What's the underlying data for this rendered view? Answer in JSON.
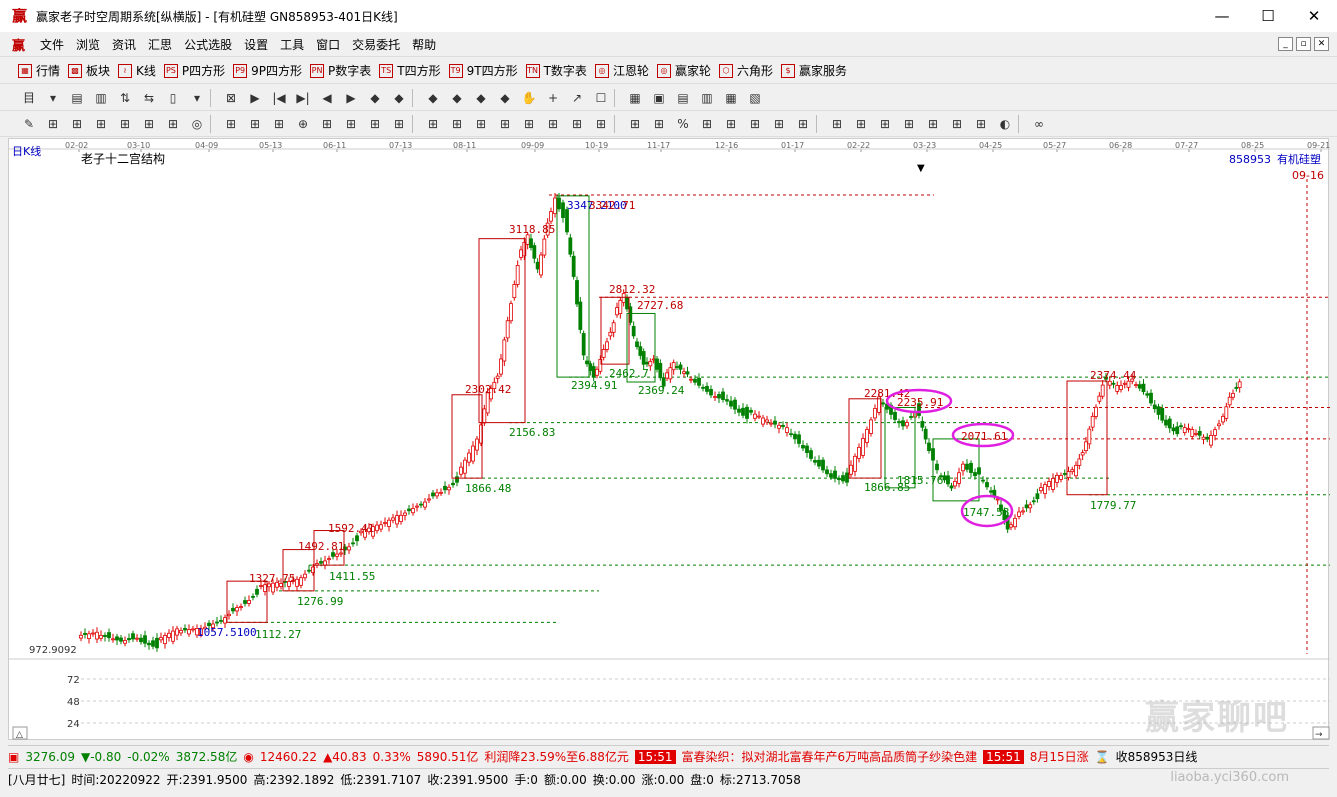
{
  "window": {
    "logo": "赢",
    "title": "赢家老子时空周期系统[纵横版] - [有机硅塑  GN858953-401日K线]",
    "buttons": [
      "—",
      "☐",
      "✕"
    ]
  },
  "menu": {
    "logo": "赢",
    "items": [
      "文件",
      "浏览",
      "资讯",
      "汇思",
      "公式选股",
      "设置",
      "工具",
      "窗口",
      "交易委托",
      "帮助"
    ],
    "right_buttons": [
      "_",
      "▫",
      "✕"
    ]
  },
  "nav": {
    "items": [
      {
        "icon": "grid-icon",
        "glyph": "▦",
        "label": "行情"
      },
      {
        "icon": "blocks-icon",
        "glyph": "▩",
        "label": "板块"
      },
      {
        "icon": "kline-icon",
        "glyph": "≀",
        "label": "K线"
      },
      {
        "icon": "ps-icon",
        "glyph": "PS",
        "label": "P四方形"
      },
      {
        "icon": "p9-icon",
        "glyph": "P9",
        "label": "9P四方形"
      },
      {
        "icon": "pn-icon",
        "glyph": "PN",
        "label": "P数字表"
      },
      {
        "icon": "ts-icon",
        "glyph": "TS",
        "label": "T四方形"
      },
      {
        "icon": "t9-icon",
        "glyph": "T9",
        "label": "9T四方形"
      },
      {
        "icon": "tn-icon",
        "glyph": "TN",
        "label": "T数字表"
      },
      {
        "icon": "wheel-icon",
        "glyph": "◎",
        "label": "江恩轮"
      },
      {
        "icon": "win-wheel-icon",
        "glyph": "◎",
        "label": "赢家轮"
      },
      {
        "icon": "hexagon-icon",
        "glyph": "⬡",
        "label": "六角形"
      },
      {
        "icon": "dollar-icon",
        "glyph": "$",
        "label": "赢家服务"
      }
    ]
  },
  "toolbar2": [
    "目",
    "▾",
    "▤",
    "▥",
    "⇅",
    "⇆",
    "▯",
    "▾",
    "⊠",
    "▶",
    "|◀",
    "▶|",
    "◀",
    "▶",
    "◆",
    "◆",
    "◆",
    "◆",
    "◆",
    "◆",
    "✋",
    "+",
    "↗",
    "☐",
    "▦",
    "▣",
    "▤",
    "▥",
    "▦",
    "▧"
  ],
  "toolbar3": [
    "✎",
    "⊞",
    "⊞",
    "⊞",
    "⊞",
    "⊞",
    "⊞",
    "◎",
    "⊞",
    "⊞",
    "⊞",
    "⊕",
    "⊞",
    "⊞",
    "⊞",
    "⊞",
    "⊞",
    "⊞",
    "⊞",
    "⊞",
    "⊞",
    "⊞",
    "⊞",
    "⊞",
    "⊞",
    "⊞",
    "%",
    "⊞",
    "⊞",
    "⊞",
    "⊞",
    "⊞",
    "⊞",
    "⊞",
    "⊞",
    "⊞",
    "⊞",
    "⊞",
    "⊞",
    "◐",
    "∞"
  ],
  "chart": {
    "period_label": "日K线",
    "study_label": "老子十二宫结构",
    "code": "858953",
    "name": "有机硅塑",
    "last_date": "09-16",
    "date_ticks": [
      "02-02",
      "03-10",
      "04-09",
      "05-13",
      "06-11",
      "07-13",
      "08-11",
      "09-09",
      "10-19",
      "11-17",
      "12-16",
      "01-17",
      "02-22",
      "03-23",
      "04-25",
      "05-27",
      "06-28",
      "07-27",
      "08-25",
      "09-21"
    ],
    "price_axis_label": "972.9092",
    "volume_ticks": [
      "72",
      "48",
      "24"
    ],
    "price_labels": [
      {
        "text": "1057.5100",
        "color": "#0000c0"
      },
      {
        "text": "1112.27",
        "color": "#008000"
      },
      {
        "text": "1327.75",
        "color": "#c00000"
      },
      {
        "text": "1276.99",
        "color": "#008000"
      },
      {
        "text": "1492.81",
        "color": "#c00000"
      },
      {
        "text": "1411.55",
        "color": "#008000"
      },
      {
        "text": "1592.41",
        "color": "#c00000"
      },
      {
        "text": "2302.42",
        "color": "#c00000"
      },
      {
        "text": "1866.48",
        "color": "#008000"
      },
      {
        "text": "3118.85",
        "color": "#c00000"
      },
      {
        "text": "2156.83",
        "color": "#008000"
      },
      {
        "text": "3347.2100",
        "color": "#0000c0"
      },
      {
        "text": "3342.71",
        "color": "#c00000"
      },
      {
        "text": "2394.91",
        "color": "#008000"
      },
      {
        "text": "2812.32",
        "color": "#c00000"
      },
      {
        "text": "2462.7",
        "color": "#008000"
      },
      {
        "text": "2727.68",
        "color": "#c00000"
      },
      {
        "text": "2369.24",
        "color": "#008000"
      },
      {
        "text": "2281.42",
        "color": "#c00000"
      },
      {
        "text": "2235.91",
        "color": "#c00000"
      },
      {
        "text": "1866.85",
        "color": "#008000"
      },
      {
        "text": "1815.76",
        "color": "#008000"
      },
      {
        "text": "2071.61",
        "color": "#c00000"
      },
      {
        "text": "1747.58",
        "color": "#008000"
      },
      {
        "text": "2374.44",
        "color": "#c00000"
      },
      {
        "text": "1779.77",
        "color": "#008000"
      }
    ]
  },
  "status1": {
    "sh_value": "3276.09",
    "sh_change": "▼-0.80",
    "sh_pct": "-0.02%",
    "sh_amount": "3872.58亿",
    "sz_value": "12460.22",
    "sz_change": "▲40.83",
    "sz_pct": "0.33%",
    "sz_amount": "5890.51亿",
    "news1": "利润降23.59%至6.88亿元",
    "time1": "15:51",
    "news2": "富春染织：拟对湖北富春年产6万吨高品质筒子纱染色建",
    "time2": "15:51",
    "news3": "8月15日涨",
    "stock_tail": "收858953日线"
  },
  "status2": {
    "lunar": "[八月廿七]",
    "time": "时间:20220922",
    "open": "开:2391.9500",
    "high": "高:2392.1892",
    "low": "低:2391.7107",
    "close": "收:2391.9500",
    "hand": "手:0",
    "amount": "额:0.00",
    "turnover": "换:0.00",
    "change": "涨:0.00",
    "plate": "盘:0",
    "mark": "标:2713.7058"
  },
  "watermark": {
    "text": "赢家聊吧",
    "url": "liaoba.yci360.com"
  }
}
